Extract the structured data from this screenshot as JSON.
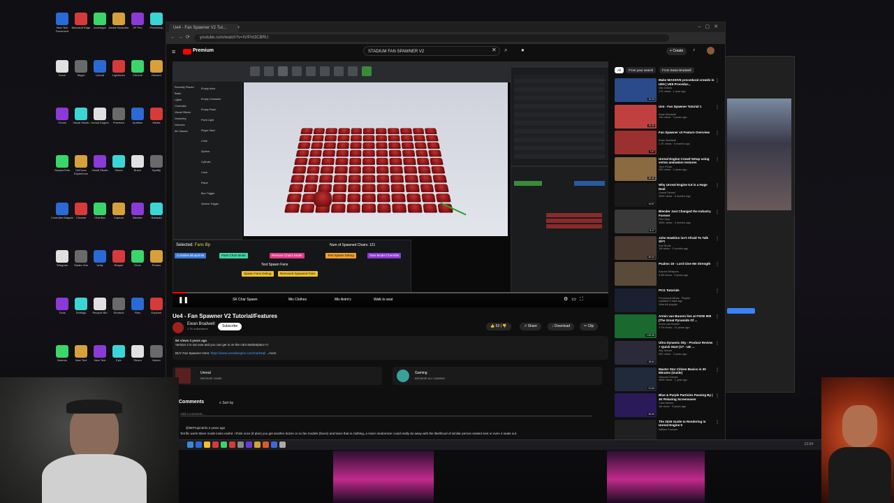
{
  "desktop": {
    "icons": [
      "New Text Document",
      "Microsoft Edge",
      "Archetype",
      "Adobe Illustrator",
      "XP Pen",
      "Photoshop",
      "Zoom",
      "Skype",
      "Unreal",
      "Lightroom",
      "Chrome",
      "Discord",
      "iTunes",
      "Visual Studio",
      "Unreal Engine",
      "Premiere",
      "Audition",
      "Media",
      "SampleTank",
      "GeForce Experience",
      "Visual Studio",
      "Steam",
      "Brave",
      "Spotify",
      "Controller Mapper",
      "Chrome",
      "Obsidian",
      "Capture",
      "Blender",
      "Notepad",
      "Telegram",
      "Studio One",
      "Unity",
      "Reaper",
      "Drive",
      "Photos",
      "Tools",
      "Settings",
      "Recycle Bin",
      "Shortcut",
      "Files",
      "Explorer",
      "Nuendo",
      "New Text",
      "New Text",
      "Epic",
      "Steam",
      "Notion"
    ]
  },
  "browser": {
    "tabs": [
      "Ue4 - Fan Spawner V2 Tut...",
      "+"
    ],
    "url": "youtube.com/watch?v=IV/Pnt3CBRU",
    "yt_logo": "Premium",
    "search_value": "STADIUM FAN SPAWNER V2",
    "create_label": "Create"
  },
  "video": {
    "selected_label": "Selected:",
    "selected_value": "Fans Bp",
    "spawned_label": "Num of Spawned Chairs:",
    "spawned_value": "121",
    "buttons": {
      "combine": "Combine Blueprints",
      "paint": "Paint Chair Mode",
      "remove": "Remove Chairs Mode",
      "test_debug": "Test Spawn Debug",
      "own_model": "Own Model Checklist",
      "test_spawn_fans": "Test Spawn Fans",
      "spawn_debug": "Spawn Fans Debug",
      "removed_spawned": "Removed Spawned Fans",
      "char_spawn": "SK Char Spawn",
      "mix_clothes": "Mix Clothes",
      "mix_anims": "Mix Anim's",
      "walk_to_seat": "Walk to seat"
    },
    "ue_sidebar": [
      "Recently Placed",
      "Basic",
      "Lights",
      "Cinematic",
      "Visual Effects",
      "Geometry",
      "Volumes",
      "All Classes"
    ],
    "ue_place": [
      "Empty Actor",
      "Empty Character",
      "Empty Pawn",
      "Point Light",
      "Player Start",
      "Cube",
      "Sphere",
      "Cylinder",
      "Cone",
      "Plane",
      "Box Trigger",
      "Sphere Trigger"
    ]
  },
  "meta": {
    "title": "Ue4 - Fan Spawner V2 Tutorial/Features",
    "channel": "Ewan Bradwell",
    "subscribers": "1.7K subscribers",
    "subscribe": "Subscribe",
    "likes": "53",
    "share": "Share",
    "download": "Download",
    "clip": "Clip",
    "desc_stats": "5K views  3 years ago",
    "desc_line1": "Version 2 is out now and you can get in on the UE4 Marketplace !!!",
    "desc_buy": "BUY Fan Spawner Here:",
    "desc_link": "https://www.unrealengine.com/marketpl",
    "desc_more": "...more",
    "tag1_title": "Unreal",
    "tag1_sub": "BROWSE GAME",
    "tag2_title": "Gaming",
    "tag2_sub": "BROWSE ALL GAMING",
    "comments_label": "Comments",
    "sort_label": "Sort by",
    "add_comment": "Add a comment...",
    "comment_user": "@MrProjectInfo  2 years ago",
    "comment_text": "Terrific work! Mixer mode looks useful. I think once (if plan) you get another dozen or so fan models (faces) and twice that in clothing, a mixer randomizer could really do away with the likelihood of similar person seated next or even 4 seats out."
  },
  "chips": [
    "All",
    "From your search",
    "From Ewan Bradwell"
  ],
  "recommendations": [
    {
      "title": "Make MASSIVE procedural crowds in UE5 | UE5 Procedur...",
      "meta": "Nils Gallow\n17K views · 1 year ago",
      "dur": "10:33",
      "color": "#2b4a8a"
    },
    {
      "title": "Ue4 - Fan Spawner Tutorial 1",
      "meta": "Ewan Bradwell\n14K views · 4 years ago",
      "dur": "19:20",
      "color": "#c04040"
    },
    {
      "title": "Fan Spawner v3 Feature Overview",
      "meta": "Ewan Bradwell\n1.7K views · 5 months ago",
      "dur": "7:07",
      "color": "#9a3030"
    },
    {
      "title": "Unreal Engine Crowd Setup using vertex animation textures",
      "meta": "Tech Photo\n20K views · 2 years ago",
      "dur": "28:40",
      "color": "#8a6a40"
    },
    {
      "title": "Why Unreal Engine 5.6 is a Huge Deal",
      "meta": "Unreal Sensei\n500K views · 6 months ago",
      "dur": "12:07",
      "color": "#1a1a1a"
    },
    {
      "title": "Blender Just Changed the Industry Forever",
      "meta": "Film Stop\n300K views · 4 months ago",
      "dur": "8:17",
      "color": "#3a3a3a"
    },
    {
      "title": "John Hawkins isn't Afraid To Talk Sh*t",
      "meta": "Rob Brolls\n1M views · 2 months ago",
      "dur": "30:32",
      "color": "#4a3a30"
    },
    {
      "title": "Psalms 18 - Lord Give Me Strength",
      "meta": "Sacred Whispers\n5.2M views · 5 years ago",
      "dur": "",
      "color": "#5a4a3a"
    },
    {
      "title": "PCG Tutorials",
      "meta": "Procedural Minds · Playlist\nUpdated 3 days ago\nView full playlist",
      "dur": "",
      "color": "#1a2030"
    },
    {
      "title": "Armin van Buuren live at FSOE 500 (The Great Pyramids Of ...",
      "meta": "Armin van Buuren\n3.7M views · 10 years ago",
      "dur": "1:59:35",
      "color": "#1a6a30"
    },
    {
      "title": "Ultra Dynamic Sky - Product Review + Quick Start (V7 - UE ...",
      "meta": "Sky Sensei\n52K views · 3 years ago",
      "dur": "18:41",
      "color": "#2a2a3a"
    },
    {
      "title": "Master Star Citizen Basics in 30 Minutes (Guide)",
      "meta": "Obscure Games\n300K views · 1 year ago",
      "dur": "31:00",
      "color": "#202a3a"
    },
    {
      "title": "Blue & Purple Particles Passing By | 4K Relaxing Screensaver",
      "meta": "Calm Waves\n4M views · 5 years ago",
      "dur": "30:00",
      "color": "#2a1a5a"
    },
    {
      "title": "The 2025 Guide to Rendering in Unreal Engine 5",
      "meta": "William Faucher\n",
      "dur": "",
      "color": "#202020"
    }
  ],
  "taskbar": {
    "time": "12:34"
  }
}
